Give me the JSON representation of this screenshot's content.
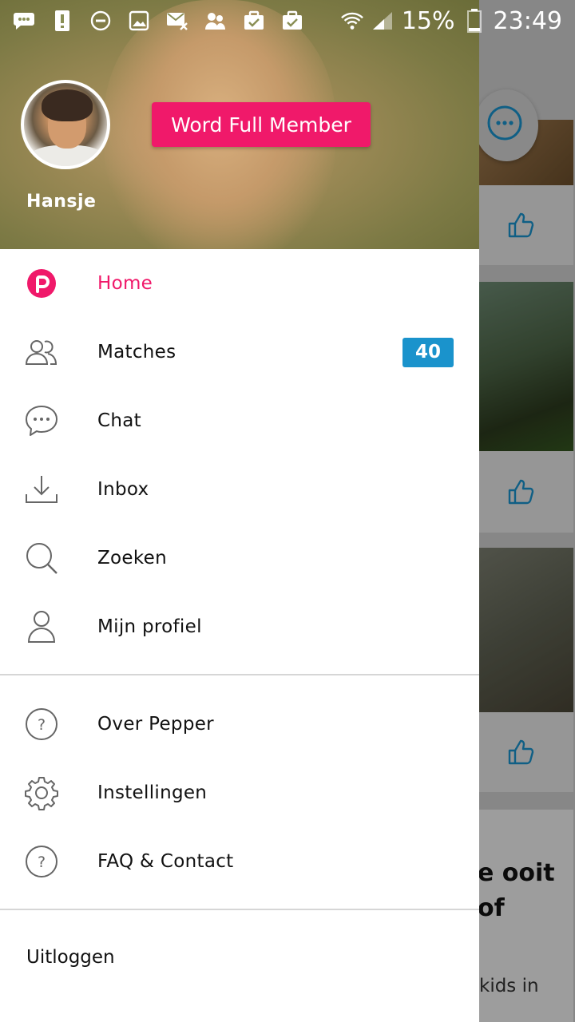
{
  "status_bar": {
    "battery_percent": "15%",
    "time": "23:49",
    "icons": [
      "chat-bubble-icon",
      "alert-icon",
      "do-not-disturb-icon",
      "image-icon",
      "mail-off-icon",
      "people-icon",
      "briefcase-check-icon",
      "briefcase-check-icon",
      "wifi-icon",
      "signal-icon",
      "battery-icon"
    ]
  },
  "drawer": {
    "profile": {
      "name": "Hansje",
      "upgrade_label": "Word Full Member"
    },
    "menu_main": [
      {
        "label": "Home",
        "icon": "pepper-logo-icon",
        "active": true
      },
      {
        "label": "Matches",
        "icon": "people-icon",
        "badge": "40"
      },
      {
        "label": "Chat",
        "icon": "chat-icon"
      },
      {
        "label": "Inbox",
        "icon": "inbox-icon"
      },
      {
        "label": "Zoeken",
        "icon": "search-icon"
      },
      {
        "label": "Mijn profiel",
        "icon": "profile-icon"
      }
    ],
    "menu_secondary": [
      {
        "label": "Over Pepper",
        "icon": "help-icon"
      },
      {
        "label": "Instellingen",
        "icon": "gear-icon"
      },
      {
        "label": "FAQ & Contact",
        "icon": "help-icon"
      }
    ],
    "logout_label": "Uitloggen"
  },
  "background": {
    "text_line_1": "e ooit",
    "text_line_2": "of",
    "text_line_3": "kids in"
  },
  "colors": {
    "accent": "#f0196a",
    "badge": "#1a93cc",
    "like_icon": "#1a93cc"
  }
}
